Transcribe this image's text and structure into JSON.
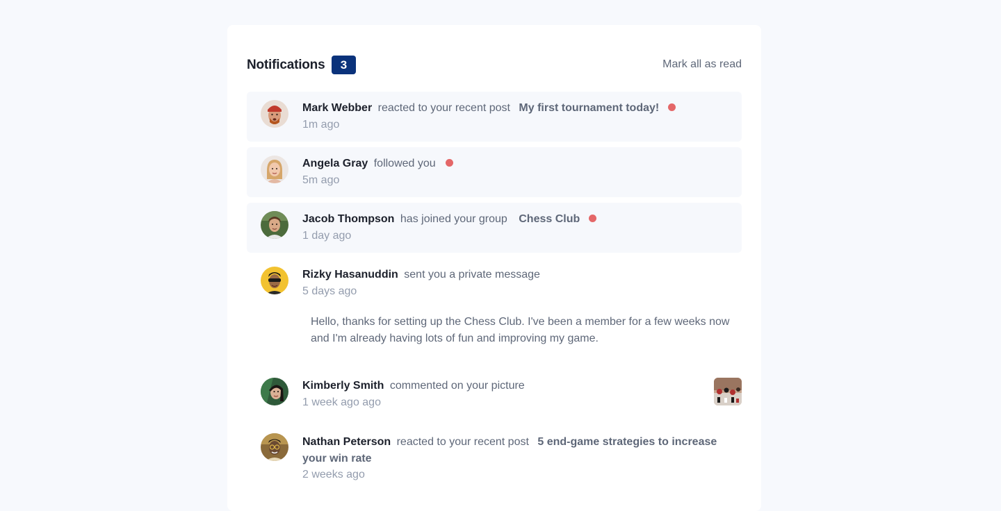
{
  "header": {
    "title": "Notifications",
    "unread_count": "3",
    "mark_all_label": "Mark all as read"
  },
  "notifications": [
    {
      "name": "Mark Webber",
      "action": "reacted to your recent post",
      "target": "My first tournament today!",
      "time": "1m ago",
      "unread": true
    },
    {
      "name": "Angela Gray",
      "action": "followed you",
      "time": "5m ago",
      "unread": true
    },
    {
      "name": "Jacob Thompson",
      "action": "has joined your group",
      "target": "Chess Club",
      "time": "1 day ago",
      "unread": true
    },
    {
      "name": "Rizky Hasanuddin",
      "action": "sent you a private message",
      "time": "5 days ago",
      "message": "Hello, thanks for setting up the Chess Club. I've been a member for a few weeks now and I'm already having lots of fun and improving my game.",
      "unread": false
    },
    {
      "name": "Kimberly Smith",
      "action": "commented on your picture",
      "time": "1 week ago ago",
      "unread": false
    },
    {
      "name": "Nathan Peterson",
      "action": "reacted to your recent post",
      "target": "5 end-game strategies to increase your win rate",
      "time": "2 weeks ago",
      "unread": false
    }
  ],
  "colors": {
    "background": "#f7f9fd",
    "card": "#ffffff",
    "badge": "#0a327b",
    "unread_bg": "#f6f8fc",
    "dot": "#e14d4d",
    "name": "#1c202b",
    "secondary": "#5e6778",
    "time": "#939cad"
  }
}
